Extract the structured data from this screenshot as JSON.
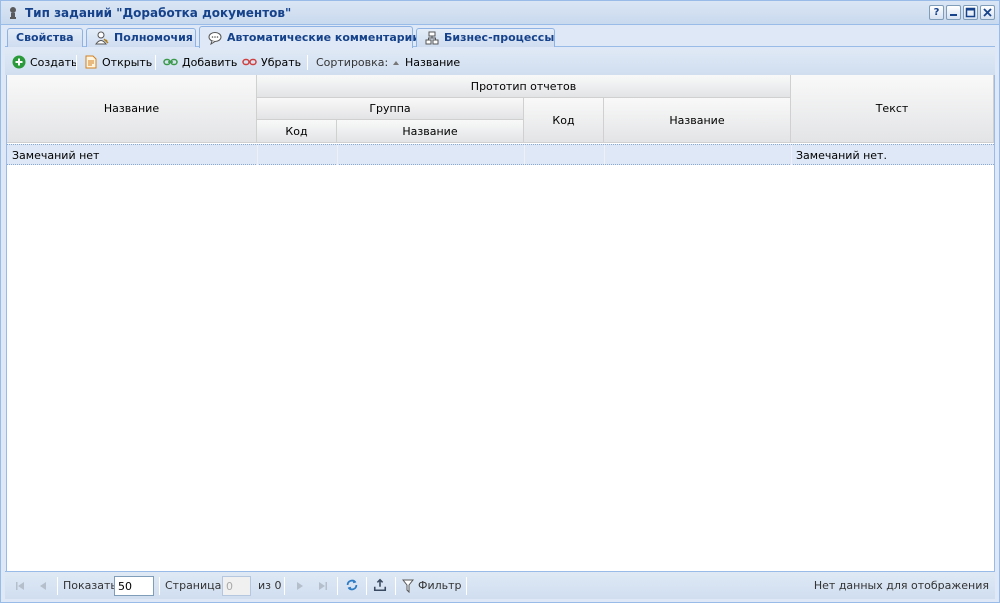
{
  "window": {
    "title": "Тип заданий \"Доработка документов\"",
    "buttons": [
      "?",
      "–",
      "□",
      "✕"
    ]
  },
  "tabs": [
    {
      "label": "Свойства",
      "icon": "",
      "active": false
    },
    {
      "label": "Полномочия",
      "icon": "user-key-icon",
      "active": false
    },
    {
      "label": "Автоматические комментарии",
      "icon": "comment-icon",
      "active": true
    },
    {
      "label": "Бизнес-процессы",
      "icon": "network-icon",
      "active": false
    }
  ],
  "toolbar": {
    "create": "Создать",
    "open": "Открыть",
    "add": "Добавить",
    "remove": "Убрать",
    "sort_label": "Сортировка:",
    "sort_value": "Название"
  },
  "grid": {
    "headers": {
      "name": "Название",
      "prototype": "Прототип отчетов",
      "group": "Группа",
      "group_code": "Код",
      "group_name": "Название",
      "code": "Код",
      "proto_name": "Название",
      "text": "Текст"
    },
    "rows": [
      {
        "name": "Замечаний нет",
        "group_code": "",
        "group_name": "",
        "code": "",
        "proto_name": "",
        "text": "Замечаний нет."
      }
    ]
  },
  "pager": {
    "show_label": "Показать",
    "page_size": "50",
    "page_label": "Страница",
    "page_value": "0",
    "of_label": "из 0",
    "filter_label": "Фильтр",
    "status": "Нет данных для отображения"
  },
  "colors": {
    "title_text": "#15428b",
    "create_icon": "#2a9a3a",
    "add_icon": "#3a9a4a",
    "remove_icon": "#d04040",
    "selected_row": "#dfe8f6"
  }
}
